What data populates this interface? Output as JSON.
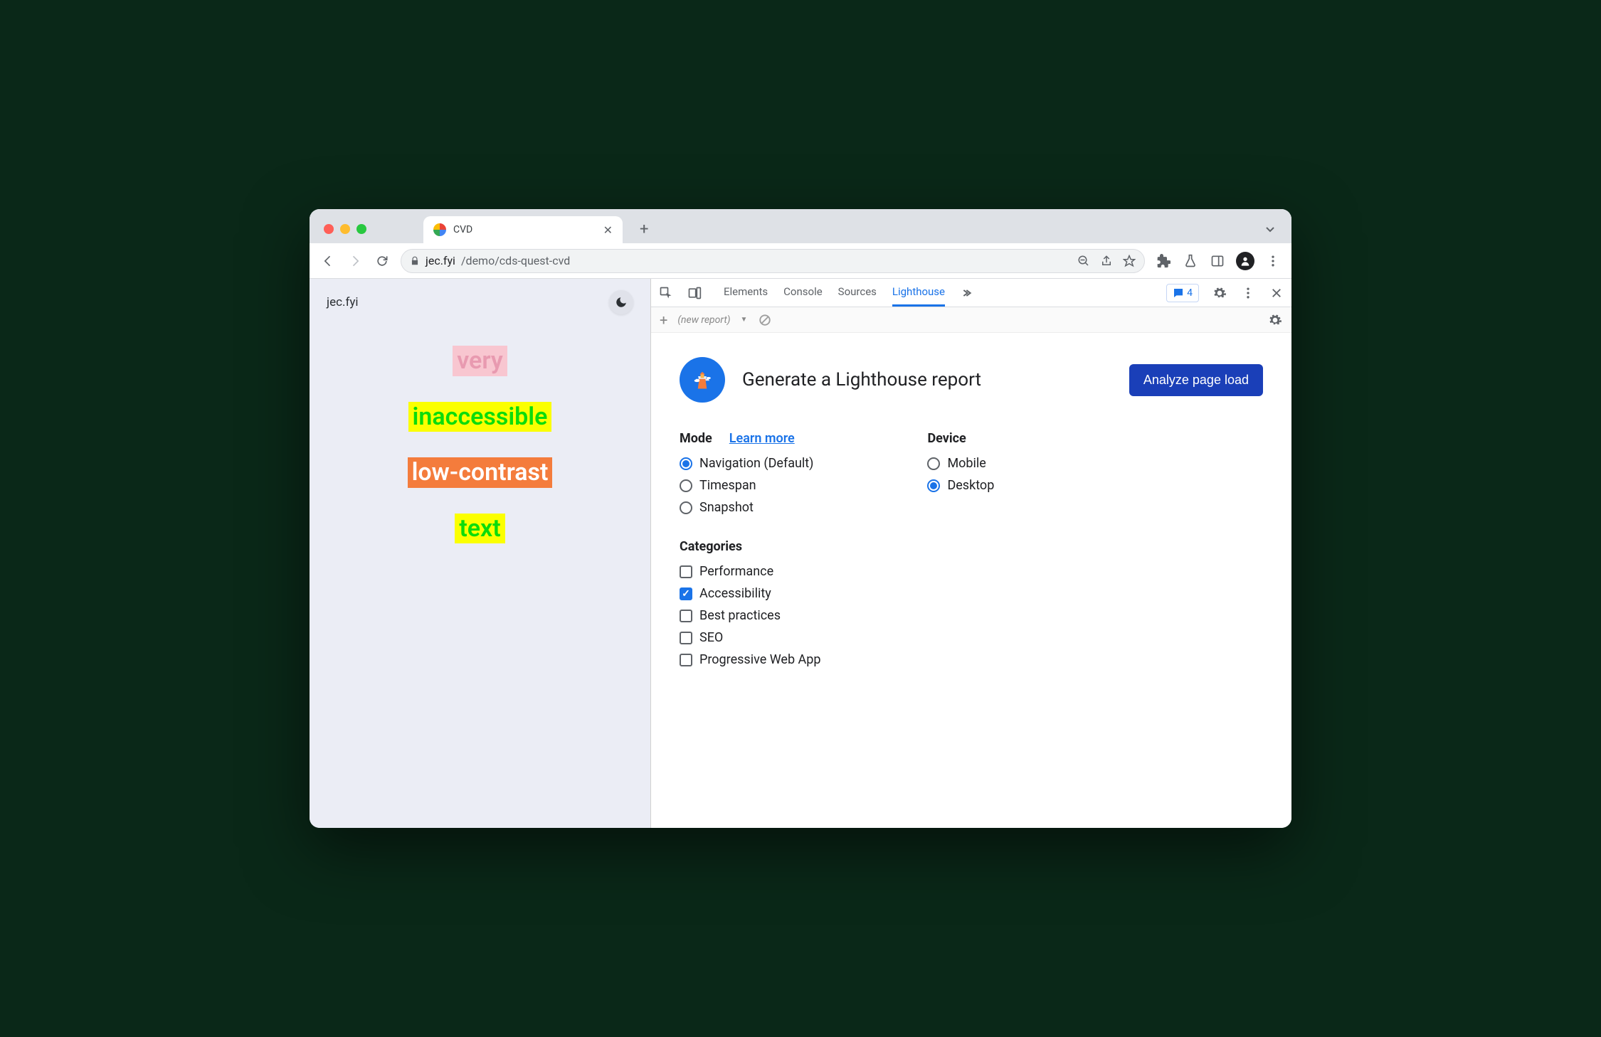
{
  "browser": {
    "tab_title": "CVD",
    "url_host": "jec.fyi",
    "url_path": "/demo/cds-quest-cvd"
  },
  "page": {
    "site_name": "jec.fyi",
    "lines": [
      "very",
      "inaccessible",
      "low-contrast",
      "text"
    ]
  },
  "devtools": {
    "tabs": [
      "Elements",
      "Console",
      "Sources",
      "Lighthouse"
    ],
    "active_tab": "Lighthouse",
    "issues_count": "4",
    "subbar": {
      "report_label": "(new report)"
    },
    "lighthouse": {
      "title": "Generate a Lighthouse report",
      "cta": "Analyze page load",
      "mode_label": "Mode",
      "learn_more": "Learn more",
      "mode_options": [
        {
          "label": "Navigation (Default)",
          "checked": true
        },
        {
          "label": "Timespan",
          "checked": false
        },
        {
          "label": "Snapshot",
          "checked": false
        }
      ],
      "device_label": "Device",
      "device_options": [
        {
          "label": "Mobile",
          "checked": false
        },
        {
          "label": "Desktop",
          "checked": true
        }
      ],
      "categories_label": "Categories",
      "categories": [
        {
          "label": "Performance",
          "checked": false
        },
        {
          "label": "Accessibility",
          "checked": true
        },
        {
          "label": "Best practices",
          "checked": false
        },
        {
          "label": "SEO",
          "checked": false
        },
        {
          "label": "Progressive Web App",
          "checked": false
        }
      ]
    }
  }
}
